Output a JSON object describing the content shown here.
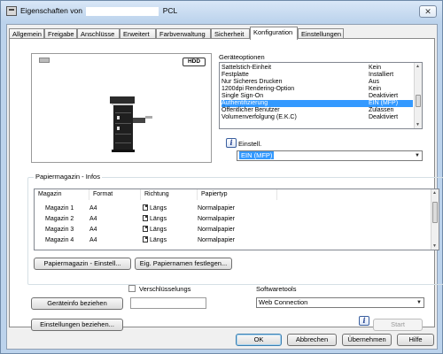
{
  "window": {
    "title_prefix": "Eigenschaften von",
    "title_suffix": "PCL",
    "close_glyph": "✕"
  },
  "tabs": [
    {
      "label": "Allgemein"
    },
    {
      "label": "Freigabe"
    },
    {
      "label": "Anschlüsse"
    },
    {
      "label": "Erweitert"
    },
    {
      "label": "Farbverwaltung"
    },
    {
      "label": "Sicherheit"
    },
    {
      "label": "Konfiguration",
      "active": true
    },
    {
      "label": "Einstellungen"
    }
  ],
  "preview": {
    "badge": "HDD",
    "icons": [
      "printer-mfp-illustration",
      "hdd-badge-icon"
    ]
  },
  "device_options": {
    "label": "Geräteoptionen",
    "items": [
      {
        "name": "Sattelstich-Einheit",
        "value": "Kein"
      },
      {
        "name": "Festplatte",
        "value": "Installiert"
      },
      {
        "name": "Nur Sicheres Drucken",
        "value": "Aus"
      },
      {
        "name": "1200dpi Rendering-Option",
        "value": "Kein"
      },
      {
        "name": "Single Sign-On",
        "value": "Deaktiviert"
      },
      {
        "name": "Authentifizierung",
        "value": "EIN (MFP)",
        "selected": true
      },
      {
        "name": "Öffentlicher Benutzer",
        "value": "Zulassen"
      },
      {
        "name": "Volumenverfolgung (E.K.C)",
        "value": "Deaktiviert"
      }
    ],
    "setting_label": "Einstell.",
    "setting_value": "EIN (MFP)"
  },
  "paper_trays": {
    "label": "Papiermagazin - Infos",
    "columns": [
      "Magazin",
      "Format",
      "Richtung",
      "Papiertyp"
    ],
    "rows": [
      [
        "Magazin 1",
        "A4",
        "Längs",
        "Normalpapier"
      ],
      [
        "Magazin 2",
        "A4",
        "Längs",
        "Normalpapier"
      ],
      [
        "Magazin 3",
        "A4",
        "Längs",
        "Normalpapier"
      ],
      [
        "Magazin 4",
        "A4",
        "Längs",
        "Normalpapier"
      ]
    ],
    "settings_button": "Papiermagazin - Einstell...",
    "names_button": "Eig. Papiernamen festlegen..."
  },
  "bottom": {
    "get_device_info": "Geräteinfo beziehen",
    "encryption_label": "Verschlüsselungs",
    "software_tools_label": "Softwaretools",
    "software_tools_value": "Web Connection",
    "get_settings": "Einstellungen beziehen...",
    "start": "Start"
  },
  "dialog_buttons": {
    "ok": "OK",
    "cancel": "Abbrechen",
    "apply": "Übernehmen",
    "help": "Hilfe"
  }
}
